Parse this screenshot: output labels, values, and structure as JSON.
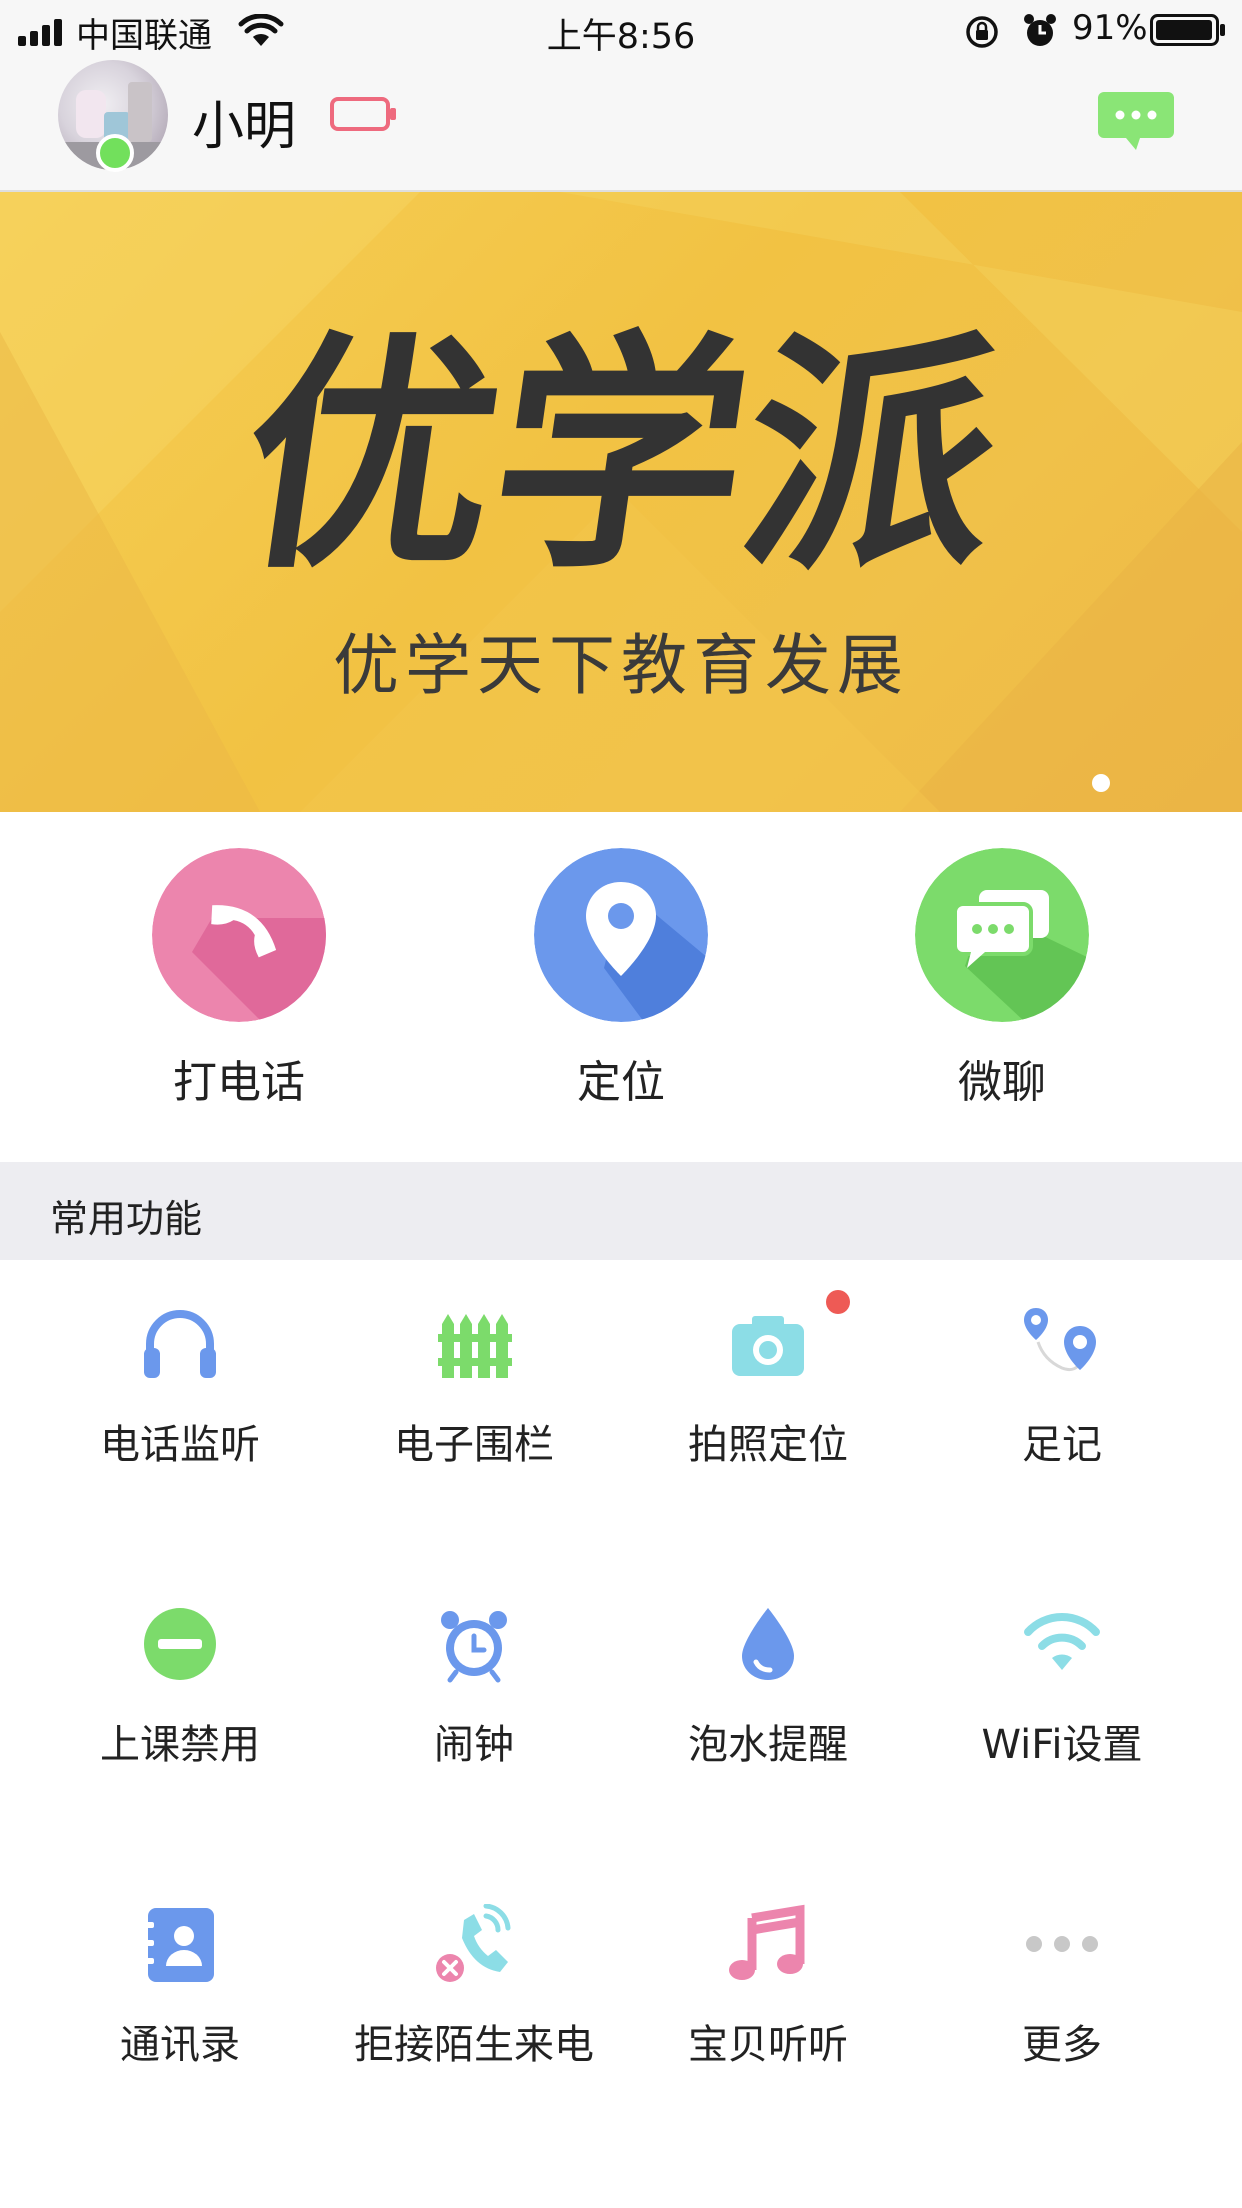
{
  "status_bar": {
    "carrier": "中国联通",
    "time": "上午8:56",
    "battery_percent": "91%"
  },
  "header": {
    "user_name": "小明",
    "online": true,
    "device_battery_icon": "low-battery-icon",
    "chat_icon": "chat-bubble-icon"
  },
  "banner": {
    "title": "优学派",
    "subtitle": "优学天下教育发展",
    "page_count": 1,
    "current_page": 1
  },
  "quick_actions": [
    {
      "label": "打电话",
      "icon": "phone-icon",
      "color": "#ec85ad"
    },
    {
      "label": "定位",
      "icon": "location-pin-icon",
      "color": "#6b98ec"
    },
    {
      "label": "微聊",
      "icon": "chat-icon",
      "color": "#7cdb6b"
    }
  ],
  "section": {
    "title": "常用功能"
  },
  "features": [
    {
      "label": "电话监听",
      "icon": "headphones-icon"
    },
    {
      "label": "电子围栏",
      "icon": "fence-icon"
    },
    {
      "label": "拍照定位",
      "icon": "camera-icon",
      "badge": true
    },
    {
      "label": "足记",
      "icon": "footprint-route-icon"
    },
    {
      "label": "上课禁用",
      "icon": "disable-icon"
    },
    {
      "label": "闹钟",
      "icon": "alarm-clock-icon"
    },
    {
      "label": "泡水提醒",
      "icon": "water-drop-icon"
    },
    {
      "label": "WiFi设置",
      "icon": "wifi-icon"
    },
    {
      "label": "通讯录",
      "icon": "contacts-icon"
    },
    {
      "label": "拒接陌生来电",
      "icon": "reject-call-icon"
    },
    {
      "label": "宝贝听听",
      "icon": "music-note-icon"
    },
    {
      "label": "更多",
      "icon": "more-icon"
    }
  ],
  "colors": {
    "blue": "#6b98ec",
    "green": "#7cdb6b",
    "cyan": "#8cdde6",
    "pink": "#ec85ad",
    "gray": "#c8c8c8",
    "banner": "#f2c243"
  }
}
